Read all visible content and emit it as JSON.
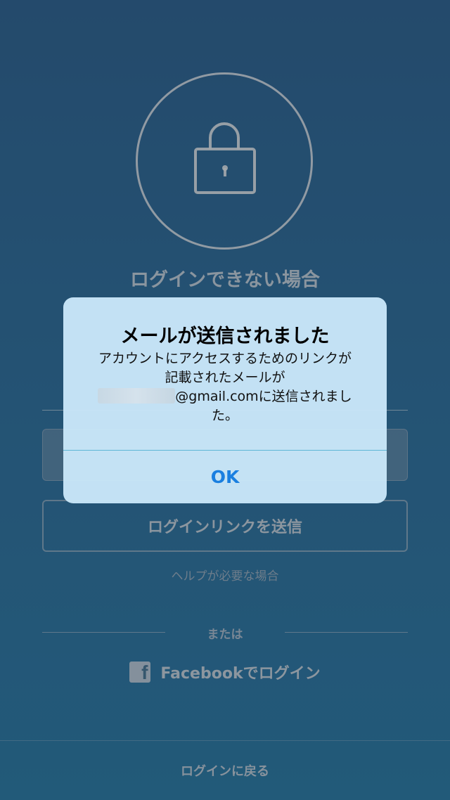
{
  "screen": {
    "heading": "ログインできない場合",
    "send_link_button": "ログインリンクを送信",
    "help_link": "ヘルプが必要な場合",
    "or_text": "または",
    "facebook_login": "Facebookでログイン",
    "back_to_login": "ログインに戻る",
    "lock_icon": "lock-icon",
    "facebook_icon": "facebook-icon"
  },
  "alert": {
    "title": "メールが送信されました",
    "message_line1": "アカウントにアクセスするためのリンクが",
    "message_line2": "記載されたメールが",
    "message_email_suffix": "@gmail.comに送信されまし",
    "message_line4": "た。",
    "ok_button": "OK"
  },
  "colors": {
    "background": "#1d5a86",
    "alert_bg": "#c8e6f8",
    "ok_text": "#1a7fe0"
  }
}
